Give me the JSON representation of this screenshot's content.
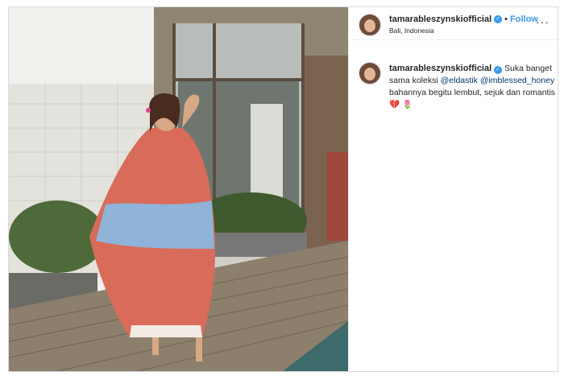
{
  "post": {
    "username": "tamarableszynskiofficial",
    "location": "Bali, Indonesia",
    "follow_label": "Follow",
    "dot": "•",
    "verified_icon": "✓",
    "more_icon": "···"
  },
  "caption": {
    "username": "tamarableszynskiofficial",
    "text_start": "Suka banget sama koleksi",
    "mention1": "@eldastik",
    "mention2": "@imblessed_honey",
    "text_end": "bahannya begitu lembut, sejuk dan romantis",
    "emoji1": "💔",
    "emoji2": "🌷"
  },
  "colors": {
    "accent": "#3897f0",
    "text": "#262626",
    "mention": "#00376b"
  }
}
